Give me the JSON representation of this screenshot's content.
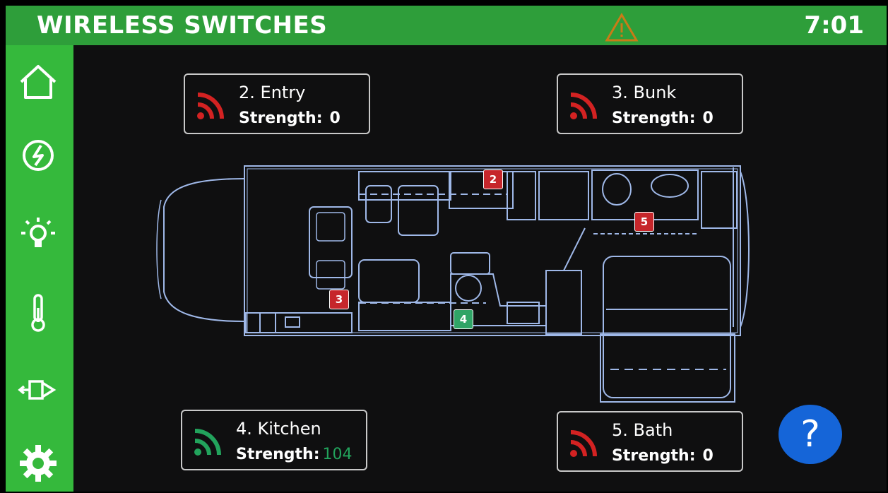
{
  "header": {
    "title": "WIRELESS SWITCHES",
    "time": "7:01"
  },
  "sidebar": {
    "items": [
      {
        "icon": "home-icon"
      },
      {
        "icon": "power-icon"
      },
      {
        "icon": "lightbulb-icon"
      },
      {
        "icon": "thermometer-icon"
      },
      {
        "icon": "slide-out-icon"
      },
      {
        "icon": "gear-icon"
      }
    ]
  },
  "switches": {
    "entry": {
      "name": "2. Entry",
      "strength_label": "Strength:",
      "strength_value": "0",
      "status_color": "#d32222"
    },
    "bunk": {
      "name": "3. Bunk",
      "strength_label": "Strength:",
      "strength_value": "0",
      "status_color": "#d32222"
    },
    "kitchen": {
      "name": "4. Kitchen",
      "strength_label": "Strength:",
      "strength_value": "104",
      "status_color": "#22a35c"
    },
    "bath": {
      "name": "5. Bath",
      "strength_label": "Strength:",
      "strength_value": "0",
      "status_color": "#d32222"
    }
  },
  "floorplan_markers": {
    "m2": "2",
    "m3": "3",
    "m4": "4",
    "m5": "5"
  },
  "help": {
    "label": "?"
  },
  "colors": {
    "header": "#2e9e3a",
    "sidebar": "#35b93c",
    "weak": "#d32222",
    "good": "#22a35c",
    "help": "#1565d8",
    "plan_line": "#9fb8e8"
  }
}
